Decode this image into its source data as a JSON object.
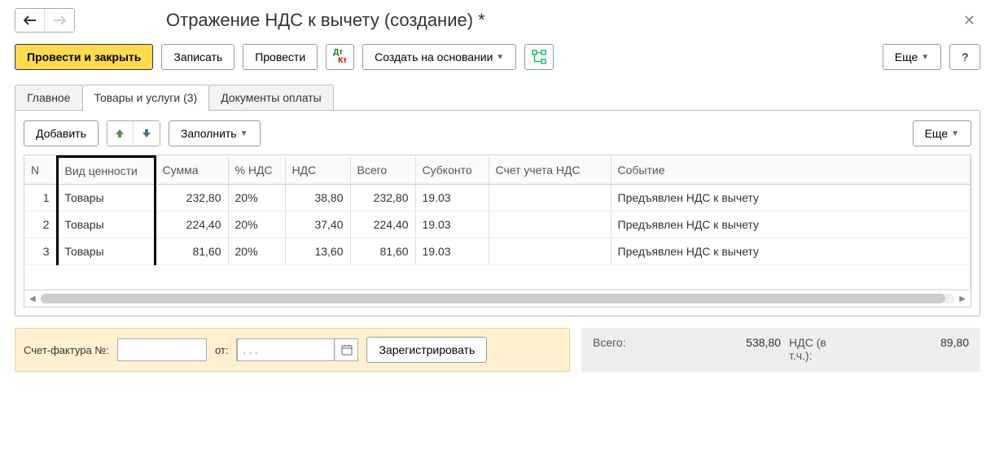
{
  "header": {
    "title": "Отражение НДС к вычету (создание) *"
  },
  "toolbar": {
    "post_close": "Провести и закрыть",
    "save": "Записать",
    "post": "Провести",
    "create_based": "Создать на основании",
    "more": "Еще",
    "help": "?"
  },
  "tabs": {
    "main": "Главное",
    "goods": "Товары и услуги (3)",
    "payments": "Документы оплаты"
  },
  "sub_toolbar": {
    "add": "Добавить",
    "fill": "Заполнить",
    "more": "Еще"
  },
  "columns": {
    "n": "N",
    "kind": "Вид ценности",
    "sum": "Сумма",
    "pct": "% НДС",
    "nds": "НДС",
    "total": "Всего",
    "sub": "Субконто",
    "acct": "Счет учета НДС",
    "event": "Событие"
  },
  "rows": [
    {
      "n": "1",
      "kind": "Товары",
      "sum": "232,80",
      "pct": "20%",
      "nds": "38,80",
      "total": "232,80",
      "sub": "19.03",
      "acct": "",
      "event": "Предъявлен НДС к вычету"
    },
    {
      "n": "2",
      "kind": "Товары",
      "sum": "224,40",
      "pct": "20%",
      "nds": "37,40",
      "total": "224,40",
      "sub": "19.03",
      "acct": "",
      "event": "Предъявлен НДС к вычету"
    },
    {
      "n": "3",
      "kind": "Товары",
      "sum": "81,60",
      "pct": "20%",
      "nds": "13,60",
      "total": "81,60",
      "sub": "19.03",
      "acct": "",
      "event": "Предъявлен НДС к вычету"
    }
  ],
  "invoice": {
    "label": "Счет-фактура №:",
    "from": "от:",
    "date_placeholder": ". . .",
    "register": "Зарегистрировать"
  },
  "totals": {
    "total_label": "Всего:",
    "total_value": "538,80",
    "nds_label": "НДС (в т.ч.):",
    "nds_value": "89,80"
  }
}
